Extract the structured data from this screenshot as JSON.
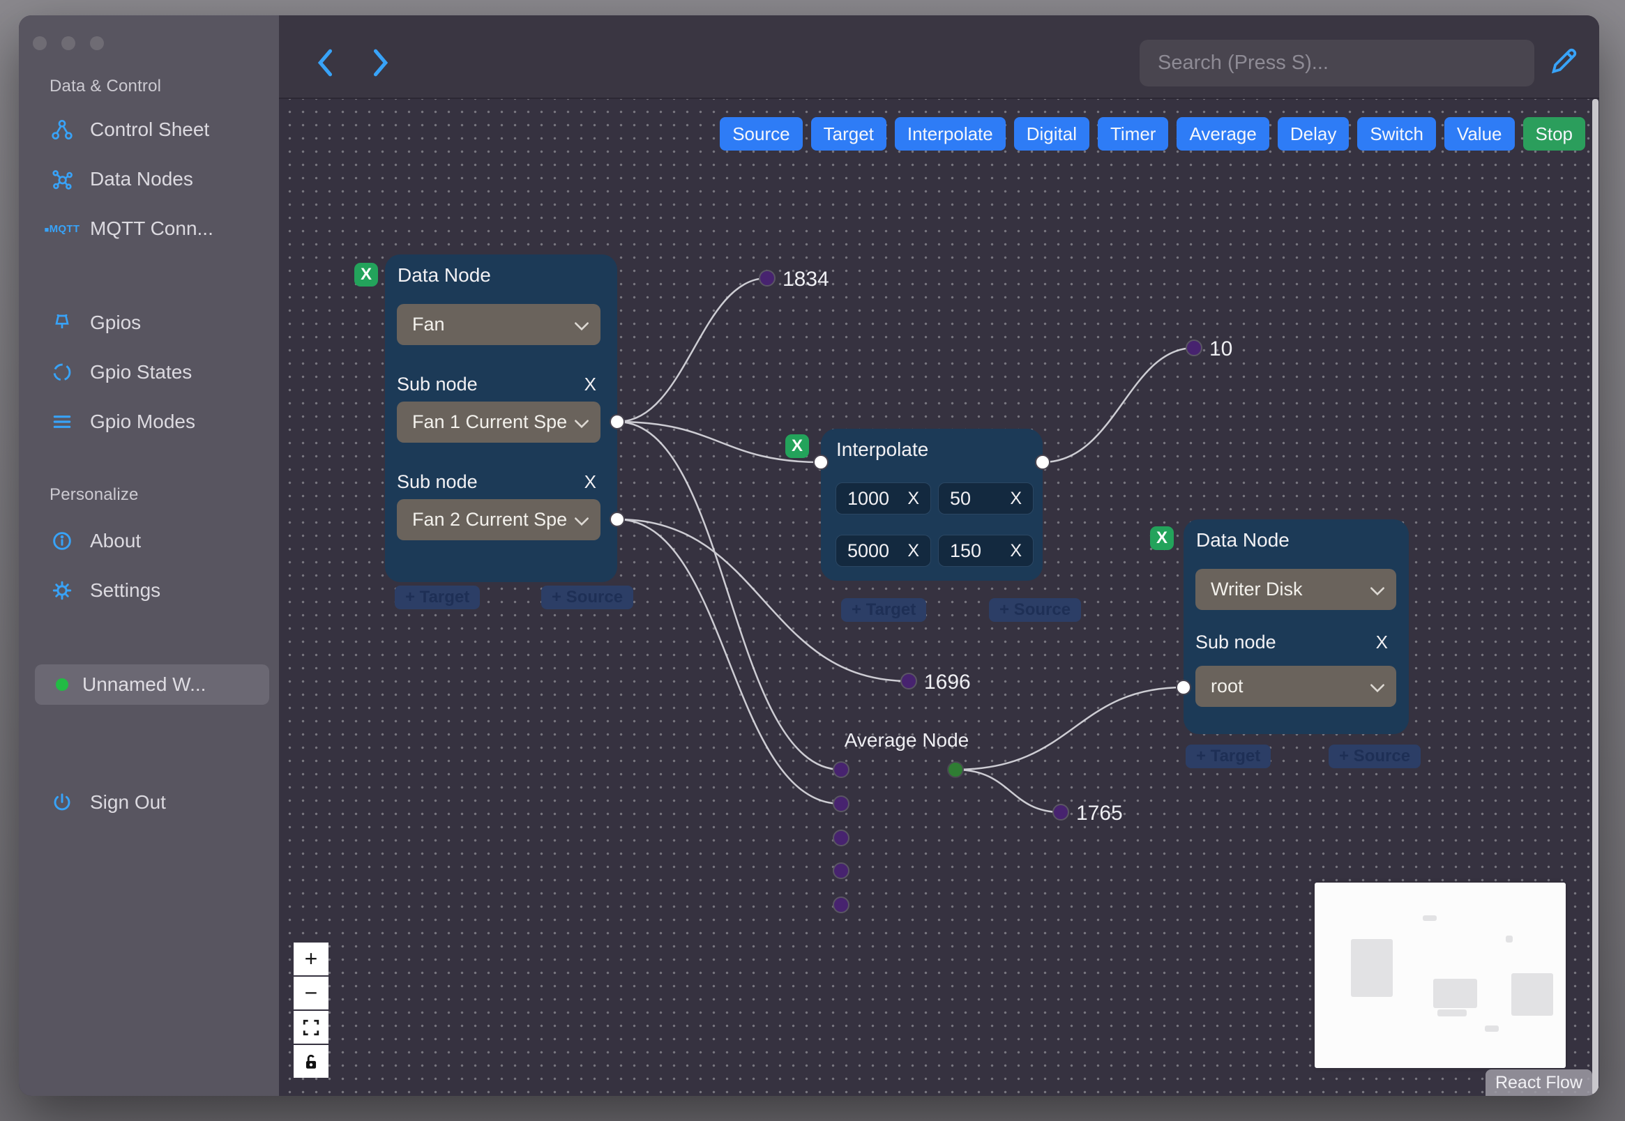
{
  "glyphs": {
    "close": "X",
    "plus": "+",
    "minus": "−"
  },
  "sidebar": {
    "section_data_control": {
      "heading": "Data & Control",
      "items": [
        {
          "label": "Control Sheet"
        },
        {
          "label": "Data Nodes"
        },
        {
          "label": "MQTT Conn..."
        }
      ]
    },
    "section_gpio": {
      "items": [
        {
          "label": "Gpios"
        },
        {
          "label": "Gpio States"
        },
        {
          "label": "Gpio Modes"
        }
      ]
    },
    "section_personalize": {
      "heading": "Personalize",
      "items": [
        {
          "label": "About"
        },
        {
          "label": "Settings"
        }
      ]
    },
    "workspace": {
      "label": "Unnamed W..."
    },
    "sign_out_label": "Sign Out",
    "mqtt_icon_text": "MQTT"
  },
  "topbar": {
    "search_placeholder": "Search (Press S)..."
  },
  "toolbar": {
    "buttons": [
      {
        "label": "Source"
      },
      {
        "label": "Target"
      },
      {
        "label": "Interpolate"
      },
      {
        "label": "Digital"
      },
      {
        "label": "Timer"
      },
      {
        "label": "Average"
      },
      {
        "label": "Delay"
      },
      {
        "label": "Switch"
      },
      {
        "label": "Value"
      },
      {
        "label": "Stop"
      }
    ]
  },
  "nodes": {
    "fan": {
      "title": "Data Node",
      "value": "Fan",
      "sub1_label": "Sub node",
      "sub1_value": "Fan 1 Current Spe",
      "sub2_label": "Sub node",
      "sub2_value": "Fan 2 Current Spe",
      "add_target": "+ Target",
      "add_source": "+ Source"
    },
    "interpolate": {
      "title": "Interpolate",
      "v1": "1000",
      "v2": "50",
      "v3": "5000",
      "v4": "150",
      "add_target": "+ Target",
      "add_source": "+ Source"
    },
    "writer": {
      "title": "Data Node",
      "value": "Writer Disk",
      "sub1_label": "Sub node",
      "sub1_value": "root",
      "add_target": "+ Target",
      "add_source": "+ Source"
    },
    "average": {
      "title": "Average Node"
    }
  },
  "edge_labels": {
    "e1": "1834",
    "e2": "10",
    "e3": "1696",
    "e4": "1765"
  },
  "attribution": "React Flow",
  "colors": {
    "accent_blue": "#2E7CF6",
    "accent_green": "#2B9E5C",
    "icon_blue": "#38A3F8",
    "node_bg": "#1C3A57",
    "edge": "#DADAE0",
    "purple_handle": "#47236F",
    "green_handle": "#2F7D33"
  }
}
